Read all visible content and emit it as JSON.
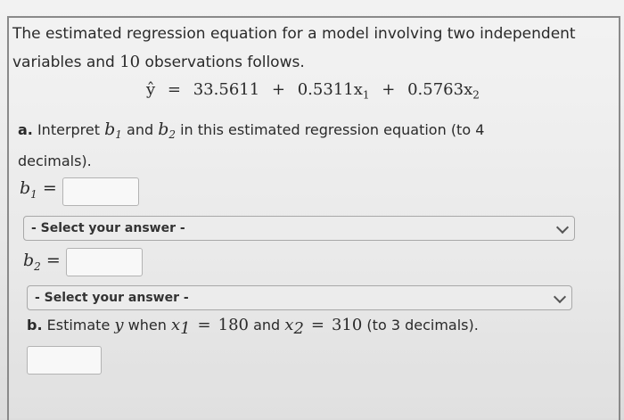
{
  "intro": {
    "line1": "The estimated regression equation for a model involving two independent",
    "line2_pre": "variables and ",
    "line2_num": "10",
    "line2_post": " observations follows."
  },
  "equation": {
    "lhs": "ŷ",
    "eq": "=",
    "b0": "33.5611",
    "plus1": "+",
    "b1": "0.5311",
    "x1": "x",
    "x1_sub": "1",
    "plus2": "+",
    "b2": "0.5763",
    "x2": "x",
    "x2_sub": "2"
  },
  "part_a": {
    "label": "a.",
    "text_pre": " Interpret ",
    "b1": "b",
    "b1_sub": "1",
    "and": " and ",
    "b2": "b",
    "b2_sub": "2",
    "text_post": " in this estimated regression equation (to 4",
    "line2": "decimals).",
    "b1_label": "b",
    "b1_label_sub": "1",
    "b2_label": "b",
    "b2_label_sub": "2",
    "equals": "=",
    "b1_value": "",
    "b2_value": "",
    "select1": "- Select your answer -",
    "select2": "- Select your answer -"
  },
  "part_b": {
    "label": "b.",
    "text1": " Estimate ",
    "y": "y",
    "text2": " when ",
    "x1": "x",
    "x1_sub": "1",
    "eq": "=",
    "x1_val": "180",
    "and": " and ",
    "x2": "x",
    "x2_sub": "2",
    "x2_val": "310",
    "text3": " (to 3 decimals).",
    "value": ""
  }
}
